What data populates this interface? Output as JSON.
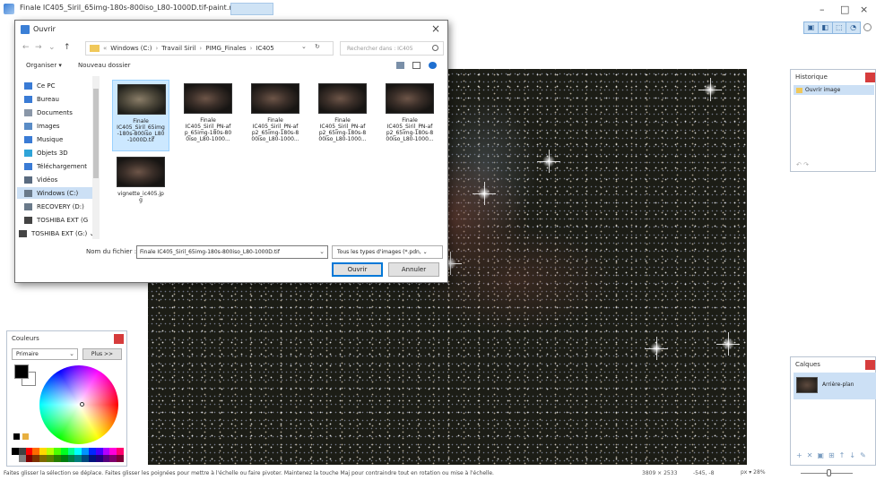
{
  "window": {
    "title": "Finale IC405_Siril_65img-180s-800iso_L80-1000D.tif-paint.net v4.0.5",
    "minimize": "–",
    "maximize": "□",
    "close": "×"
  },
  "toolbar": {
    "icons": [
      "select-tool-icon",
      "move-tool-icon",
      "lasso-tool-icon",
      "zoom-tool-icon"
    ],
    "strip_labels": [
      "▣",
      "◧",
      "⬚",
      "◔"
    ]
  },
  "dialog": {
    "title": "Ouvrir",
    "close": "×",
    "nav": {
      "back": "←",
      "forward": "→",
      "up": "↑",
      "refresh": "↻",
      "dropdown": "⌄"
    },
    "breadcrumb": [
      "Windows (C:)",
      "Travail Siril",
      "PIMG_Finales",
      "IC405"
    ],
    "breadcrumb_prefix": "«",
    "search_placeholder": "Rechercher dans : IC405",
    "organize": "Organiser ▾",
    "new_folder": "Nouveau dossier",
    "nav_items": [
      {
        "label": "Ce PC",
        "icon": "computer-icon",
        "color": "#3a7bd5"
      },
      {
        "label": "Bureau",
        "icon": "desktop-icon",
        "color": "#3a7bd5"
      },
      {
        "label": "Documents",
        "icon": "documents-icon",
        "color": "#8a97a8"
      },
      {
        "label": "Images",
        "icon": "pictures-icon",
        "color": "#5a8cc6"
      },
      {
        "label": "Musique",
        "icon": "music-icon",
        "color": "#3a7bd5"
      },
      {
        "label": "Objets 3D",
        "icon": "objects-3d-icon",
        "color": "#2fa4d8"
      },
      {
        "label": "Téléchargement",
        "icon": "downloads-icon",
        "color": "#3a7bd5"
      },
      {
        "label": "Vidéos",
        "icon": "videos-icon",
        "color": "#5a6b80"
      },
      {
        "label": "Windows (C:)",
        "icon": "drive-icon",
        "color": "#6a7a8a"
      },
      {
        "label": "RECOVERY (D:)",
        "icon": "drive-icon",
        "color": "#6a7a8a"
      },
      {
        "label": "TOSHIBA EXT (G",
        "icon": "external-drive-icon",
        "color": "#444444"
      },
      {
        "label": "TOSHIBA EXT (G:) ⌄",
        "icon": "external-drive-icon",
        "color": "#444444"
      }
    ],
    "files": [
      {
        "label": "Finale\nIC405_Siril_65img\n-180s-800iso_L80\n-1000D.tif",
        "selected": true
      },
      {
        "label": "Finale\nIC405_Siril_PN-af\np_65img-180s-80\n0iso_L80-1000...",
        "selected": false
      },
      {
        "label": "Finale\nIC405_Siril_PN-af\np2_65img-180s-8\n00iso_L80-1000...",
        "selected": false
      },
      {
        "label": "Finale\nIC405_Siril_PN-af\np2_65img-180s-8\n00iso_L80-1000...",
        "selected": false
      },
      {
        "label": "Finale\nIC405_Siril_PN-af\np2_65img-180s-8\n00iso_L80-1000...",
        "selected": false
      },
      {
        "label": "vignette_ic405.jp\ng",
        "selected": false
      }
    ],
    "filename_label": "Nom du fichier :",
    "filename_value": "Finale IC405_Siril_65img-180s-800iso_L80-1000D.tif",
    "filetype_value": "Tous les types d'images (*.pdn, ⌄",
    "open_button": "Ouvrir",
    "cancel_button": "Annuler"
  },
  "history": {
    "title": "Historique",
    "items": [
      "Ouvrir image"
    ],
    "undo_redo": "↶ ↷"
  },
  "layers": {
    "title": "Calques",
    "items": [
      "Arrière-plan"
    ],
    "tools": [
      "+",
      "✕",
      "▣",
      "⊞",
      "↑",
      "↓",
      "✎"
    ]
  },
  "colors": {
    "title": "Couleurs",
    "mode": "Primaire",
    "more_button": "Plus >>",
    "primary": "#000000",
    "secondary": "#ffffff",
    "palette": [
      "#000000",
      "#404040",
      "#ff0000",
      "#ff6a00",
      "#ffd800",
      "#b6ff00",
      "#4cff00",
      "#00ff21",
      "#00ff90",
      "#00ffff",
      "#0094ff",
      "#0026ff",
      "#4800ff",
      "#b200ff",
      "#ff00dc",
      "#ff006e",
      "#ffffff",
      "#808080",
      "#7f0000",
      "#7f3300",
      "#7f6a00",
      "#5b7f00",
      "#267f00",
      "#007f0e",
      "#007f46",
      "#007f7f",
      "#004a7f",
      "#00137f",
      "#21007f",
      "#57007f",
      "#7f006e",
      "#7f0037"
    ]
  },
  "status": {
    "message": "Faites glisser la sélection se déplace. Faites glisser les poignées pour mettre à l'échelle ou faire pivoter. Maintenez la touche Maj pour contraindre tout en rotation ou mise à l'échelle.",
    "image_size": "3809 × 2533",
    "cursor_pos": "-545, -8",
    "units_zoom": "px ▾  28%"
  }
}
